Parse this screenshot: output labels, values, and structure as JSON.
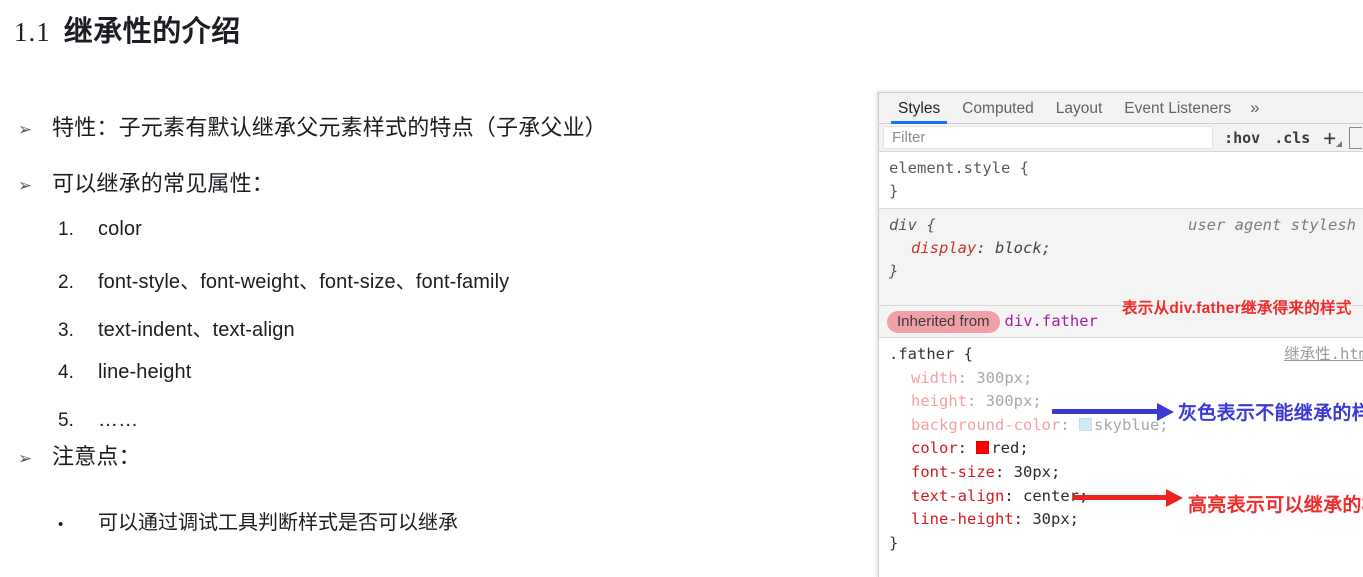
{
  "slide": {
    "title": {
      "number": "1.1",
      "text": "继承性的介绍"
    },
    "bullets": [
      {
        "level": 1,
        "marker": "➢",
        "text": "特性：子元素有默认继承父元素样式的特点（子承父业）"
      },
      {
        "level": 1,
        "marker": "➢",
        "text": "可以继承的常见属性："
      },
      {
        "level": 2,
        "marker": "1.",
        "text": "color"
      },
      {
        "level": 2,
        "marker": "2.",
        "text": "font-style、font-weight、font-size、font-family"
      },
      {
        "level": 2,
        "marker": "3.",
        "text": "text-indent、text-align"
      },
      {
        "level": 2,
        "marker": "4.",
        "text": "line-height"
      },
      {
        "level": 2,
        "marker": "5.",
        "text": "……"
      },
      {
        "level": 1,
        "marker": "➢",
        "text": "注意点："
      },
      {
        "level": 3,
        "marker": "•",
        "text": "可以通过调试工具判断样式是否可以继承"
      }
    ]
  },
  "devtools": {
    "tabs": [
      {
        "label": "Styles",
        "active": true
      },
      {
        "label": "Computed",
        "active": false
      },
      {
        "label": "Layout",
        "active": false
      },
      {
        "label": "Event Listeners",
        "active": false
      }
    ],
    "more_tabs_icon": "»",
    "filter": {
      "placeholder": "Filter",
      "value": ""
    },
    "toolbar": {
      "hov_label": ":hov",
      "cls_label": ".cls",
      "new_rule_icon": "+",
      "new_rule_name": "plus-icon",
      "sidebar_toggle_name": "computed-sidebar-toggle"
    },
    "rules": [
      {
        "id": "element-style",
        "selector": "element.style {",
        "close": "}",
        "source": "",
        "declarations": []
      },
      {
        "id": "user-agent-div",
        "selector": "div {",
        "close": "}",
        "source": "user agent stylesh",
        "declarations": [
          {
            "prop": "display",
            "value": "block;",
            "inheritable": true
          }
        ]
      }
    ],
    "inherited": {
      "pill_label": "Inherited from",
      "target": "div.father"
    },
    "father_rule": {
      "selector": ".father {",
      "close": "}",
      "source_link": "继承性.htm",
      "declarations": [
        {
          "prop": "width",
          "value": "300px;",
          "inheritable": false,
          "swatch": ""
        },
        {
          "prop": "height",
          "value": "300px;",
          "inheritable": false,
          "swatch": ""
        },
        {
          "prop": "background-color",
          "value": "skyblue;",
          "inheritable": false,
          "swatch": "skyblue"
        },
        {
          "prop": "color",
          "value": "red;",
          "inheritable": true,
          "swatch": "red"
        },
        {
          "prop": "font-size",
          "value": "30px;",
          "inheritable": true,
          "swatch": ""
        },
        {
          "prop": "text-align",
          "value": "center;",
          "inheritable": true,
          "swatch": ""
        },
        {
          "prop": "line-height",
          "value": "30px;",
          "inheritable": true,
          "swatch": ""
        }
      ]
    }
  },
  "annotations": [
    {
      "id": "inherit-note",
      "text": "表示从div.father继承得来的样式",
      "color": "#ef2b2b"
    },
    {
      "id": "gray-note",
      "text": "灰色表示不能继承的样",
      "color": "#3b3bd4"
    },
    {
      "id": "highlight-note",
      "text": "高亮表示可以继承的样",
      "color": "#ef2b2b"
    }
  ],
  "colors": {
    "accent_tab": "#1a73e8",
    "inherited_pill": "#f2a0a8",
    "blue_anno": "#3b3bd4",
    "red_anno": "#ef2b2b",
    "swatch_skyblue": "#cfeaf5",
    "swatch_red": "#ff0000"
  }
}
